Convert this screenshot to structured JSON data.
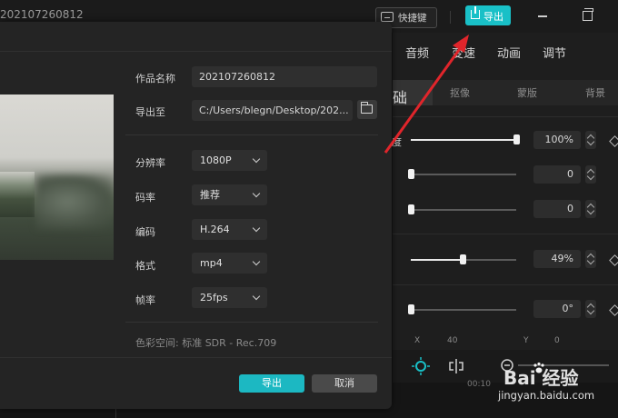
{
  "titlebar": {
    "title": "202107260812",
    "shortcut_label": "快捷键",
    "export_label": "导出"
  },
  "right_panel": {
    "tabs": [
      "音频",
      "变速",
      "动画",
      "调节"
    ],
    "sub_tabs": [
      "础",
      "抠像",
      "蒙版",
      "背景"
    ],
    "partial_label": "度",
    "values": [
      "100%",
      "0",
      "0",
      "49%",
      "0°"
    ],
    "slider_fractions": [
      1.0,
      0.0,
      0.0,
      0.49,
      0.0
    ],
    "xy": {
      "x_label": "X",
      "x_value": "40",
      "y_label": "Y",
      "y_value": "0"
    }
  },
  "timeline": {
    "ruler_text": "00:10"
  },
  "dialog": {
    "fields": {
      "name_label": "作品名称",
      "name_value": "202107260812",
      "path_label": "导出至",
      "path_value": "C:/Users/blegn/Desktop/202...",
      "resolution_label": "分辨率",
      "resolution_value": "1080P",
      "bitrate_label": "码率",
      "bitrate_value": "推荐",
      "codec_label": "编码",
      "codec_value": "H.264",
      "format_label": "格式",
      "format_value": "mp4",
      "fps_label": "帧率",
      "fps_value": "25fps"
    },
    "color_space": "色彩空间: 标准 SDR - Rec.709",
    "export_button": "导出",
    "cancel_button": "取消"
  },
  "watermark": {
    "logo_text": "Bai 经验",
    "url": "jingyan.baidu.com"
  },
  "colors": {
    "accent": "#1cb8c2",
    "arrow": "#e0252b"
  }
}
